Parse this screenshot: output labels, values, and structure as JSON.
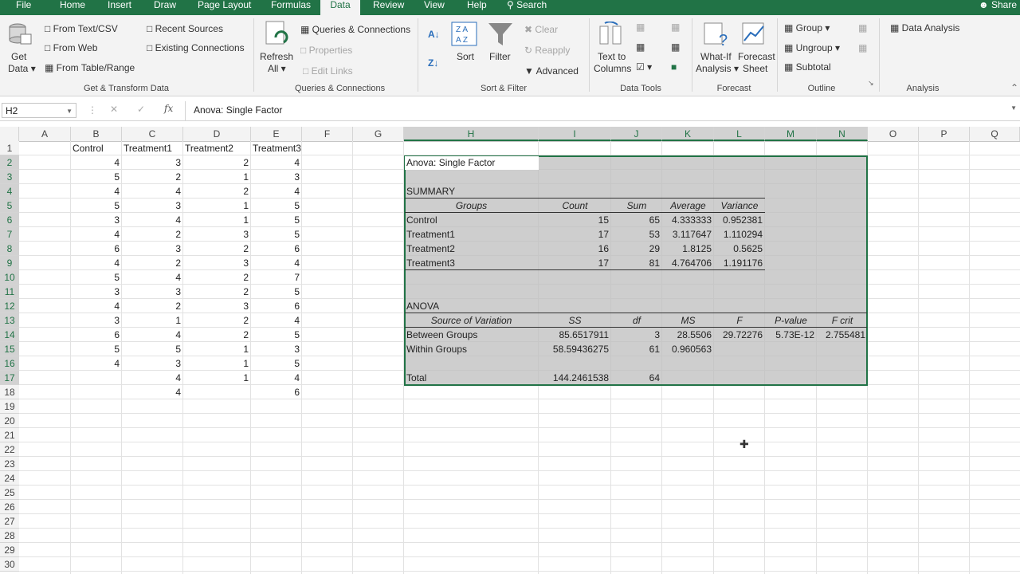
{
  "tabs": [
    "File",
    "Home",
    "Insert",
    "Draw",
    "Page Layout",
    "Formulas",
    "Data",
    "Review",
    "View",
    "Help"
  ],
  "active_tab": "Data",
  "search_label": "Search",
  "share_label": "Share",
  "ribbon": {
    "get_data": [
      "Get",
      "Data"
    ],
    "from_text_csv": "From Text/CSV",
    "from_web": "From Web",
    "from_table": "From Table/Range",
    "recent_sources": "Recent Sources",
    "existing_connections": "Existing Connections",
    "refresh_all": [
      "Refresh",
      "All"
    ],
    "queries_connections": "Queries & Connections",
    "properties": "Properties",
    "edit_links": "Edit Links",
    "sort": "Sort",
    "filter": "Filter",
    "clear": "Clear",
    "reapply": "Reapply",
    "advanced": "Advanced",
    "text_to_columns": [
      "Text to",
      "Columns"
    ],
    "what_if": [
      "What-If",
      "Analysis"
    ],
    "forecast_sheet": [
      "Forecast",
      "Sheet"
    ],
    "group": "Group",
    "ungroup": "Ungroup",
    "subtotal": "Subtotal",
    "data_analysis": "Data Analysis",
    "groups": {
      "get_transform": "Get & Transform Data",
      "queries": "Queries & Connections",
      "sort_filter": "Sort & Filter",
      "data_tools": "Data Tools",
      "forecast": "Forecast",
      "outline": "Outline",
      "analysis": "Analysis"
    }
  },
  "namebox": "H2",
  "formula": "Anova: Single Factor",
  "fx_label": "fx",
  "columns": [
    "A",
    "B",
    "C",
    "D",
    "E",
    "F",
    "G",
    "H",
    "I",
    "J",
    "K",
    "L",
    "M",
    "N",
    "O",
    "P",
    "Q"
  ],
  "rows": [
    "1",
    "2",
    "3",
    "4",
    "5",
    "6",
    "7",
    "8",
    "9",
    "10",
    "11",
    "12",
    "13",
    "14",
    "15",
    "16",
    "17",
    "18",
    "19",
    "20",
    "21",
    "22",
    "23",
    "24",
    "25",
    "26",
    "27",
    "28",
    "29",
    "30"
  ],
  "headers": [
    "Control",
    "Treatment1",
    "Treatment2",
    "Treatment3"
  ],
  "data_cols": {
    "control": [
      "4",
      "5",
      "4",
      "5",
      "3",
      "4",
      "6",
      "4",
      "5",
      "3",
      "4",
      "3",
      "6",
      "5",
      "4"
    ],
    "t1": [
      "3",
      "2",
      "4",
      "3",
      "4",
      "2",
      "3",
      "2",
      "4",
      "3",
      "2",
      "1",
      "4",
      "5",
      "3",
      "4",
      "4"
    ],
    "t2": [
      "2",
      "1",
      "2",
      "1",
      "1",
      "3",
      "2",
      "3",
      "2",
      "2",
      "3",
      "2",
      "2",
      "1",
      "1",
      "1"
    ],
    "t3": [
      "4",
      "3",
      "4",
      "5",
      "5",
      "5",
      "6",
      "4",
      "7",
      "5",
      "6",
      "4",
      "5",
      "3",
      "5",
      "4",
      "6"
    ]
  },
  "anova": {
    "title": "Anova: Single Factor",
    "summary_label": "SUMMARY",
    "summary_headers": [
      "Groups",
      "Count",
      "Sum",
      "Average",
      "Variance"
    ],
    "summary_rows": [
      [
        "Control",
        "15",
        "65",
        "4.333333",
        "0.952381"
      ],
      [
        "Treatment1",
        "17",
        "53",
        "3.117647",
        "1.110294"
      ],
      [
        "Treatment2",
        "16",
        "29",
        "1.8125",
        "0.5625"
      ],
      [
        "Treatment3",
        "17",
        "81",
        "4.764706",
        "1.191176"
      ]
    ],
    "anova_label": "ANOVA",
    "anova_headers": [
      "Source of Variation",
      "SS",
      "df",
      "MS",
      "F",
      "P-value",
      "F crit"
    ],
    "between": [
      "Between Groups",
      "85.6517911",
      "3",
      "28.5506",
      "29.72276",
      "5.73E-12",
      "2.755481"
    ],
    "within": [
      "Within Groups",
      "58.59436275",
      "61",
      "0.960563"
    ],
    "total": [
      "Total",
      "144.2461538",
      "64"
    ]
  },
  "colors": {
    "accent": "#217346",
    "selection": "#bebebe"
  }
}
